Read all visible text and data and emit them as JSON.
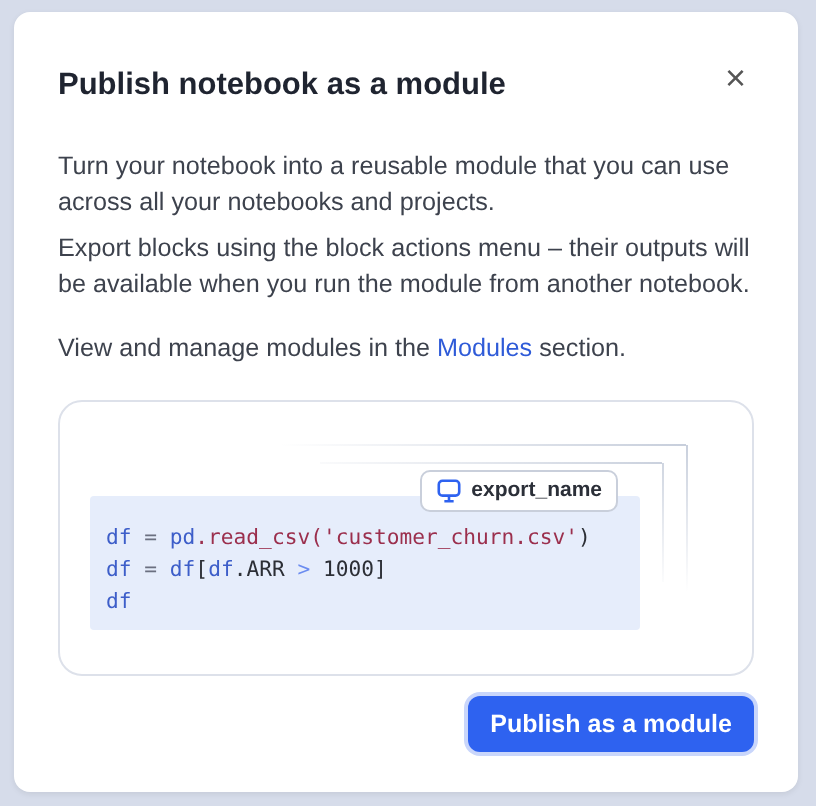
{
  "dialog": {
    "title": "Publish notebook as a module",
    "close": "×",
    "paragraphs": [
      "Turn your notebook into a reusable module that you can use across all your notebooks and projects.",
      "Export blocks using the block actions menu – their outputs will be available when you run the module from another notebook."
    ],
    "manage": {
      "before": "View and manage modules in the ",
      "link": "Modules",
      "after": " section."
    },
    "illustration": {
      "tag": "export_name",
      "code_lines": [
        [
          {
            "text": "df",
            "kind": "var"
          },
          {
            "text": " = ",
            "kind": "op"
          },
          {
            "text": "pd",
            "kind": "var"
          },
          {
            "text": ".read_csv(",
            "kind": "fn"
          },
          {
            "text": "'customer_churn.csv'",
            "kind": "str"
          },
          {
            "text": ")",
            "kind": "punct"
          }
        ],
        [
          {
            "text": "df",
            "kind": "var"
          },
          {
            "text": " = ",
            "kind": "op"
          },
          {
            "text": "df",
            "kind": "var"
          },
          {
            "text": "[",
            "kind": "punct"
          },
          {
            "text": "df",
            "kind": "var"
          },
          {
            "text": ".ARR ",
            "kind": "punct"
          },
          {
            "text": ">",
            "kind": "cmp"
          },
          {
            "text": " 1000]",
            "kind": "punct"
          }
        ],
        [
          {
            "text": "df",
            "kind": "var"
          }
        ]
      ]
    },
    "primary_button": "Publish as a module"
  }
}
